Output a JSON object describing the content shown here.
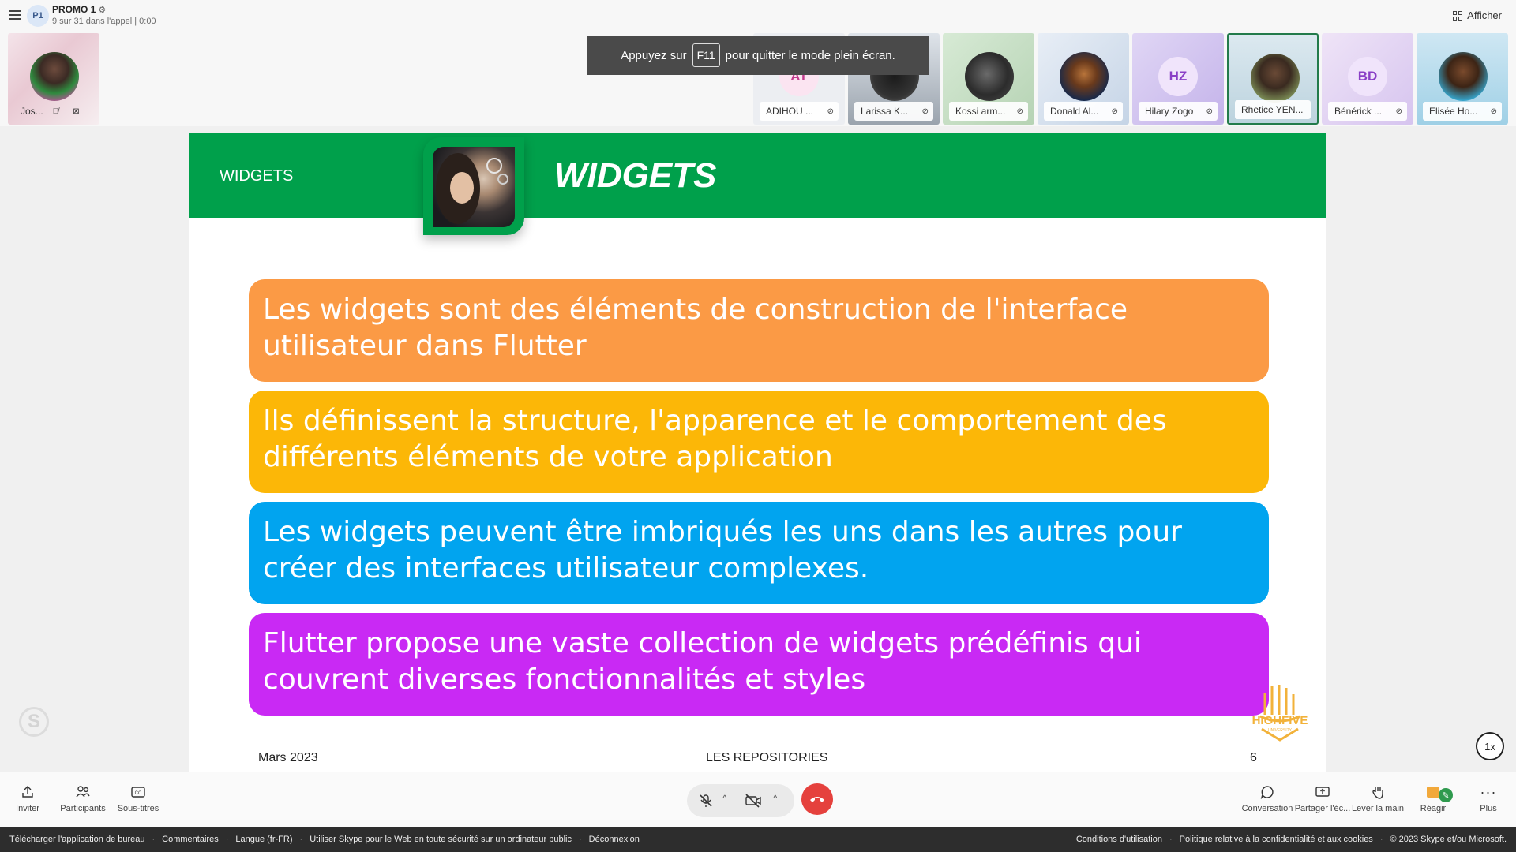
{
  "header": {
    "group_initials": "P1",
    "title": "PROMO 1",
    "subtitle": "9 sur 31 dans l'appel | 0:00",
    "view_label": "Afficher"
  },
  "self_tile": {
    "name": "Jos..."
  },
  "fullscreen_toast": {
    "before": "Appuyez sur",
    "key": "F11",
    "after": "pour quitter le mode plein écran."
  },
  "participants": [
    {
      "name": "ADIHOU ...",
      "initials": "AT"
    },
    {
      "name": "Larissa K...",
      "initials": ""
    },
    {
      "name": "Kossi arm...",
      "initials": ""
    },
    {
      "name": "Donald Al...",
      "initials": ""
    },
    {
      "name": "Hilary Zogo",
      "initials": "HZ"
    },
    {
      "name": "Rhetice YEN...",
      "initials": ""
    },
    {
      "name": "Bénérick ...",
      "initials": "BD"
    },
    {
      "name": "Elisée Ho...",
      "initials": ""
    }
  ],
  "slide": {
    "band_label": "WIDGETS",
    "title": "WIDGETS",
    "points": [
      "Les widgets sont des éléments de construction de l'interface utilisateur dans Flutter",
      "Ils définissent la structure, l'apparence et le comportement des différents éléments de votre application",
      "Les widgets peuvent être imbriqués les uns dans les autres pour créer des interfaces utilisateur complexes.",
      "Flutter propose une vaste collection de widgets prédéfinis qui couvrent diverses fonctionnalités et styles"
    ],
    "logo_text": "HIGHFIVE",
    "logo_subtext": "UNIVERSITY",
    "footer_date": "Mars 2023",
    "footer_center": "LES REPOSITORIES",
    "footer_page": "6"
  },
  "speed": "1x",
  "toolbar": {
    "invite": "Inviter",
    "participants": "Participants",
    "captions": "Sous-titres",
    "conversation": "Conversation",
    "share": "Partager l'éc...",
    "raise_hand": "Lever la main",
    "react": "Réagir",
    "more": "Plus"
  },
  "statusbar": {
    "left": [
      "Télécharger l'application de bureau",
      "Commentaires",
      "Langue (fr-FR)",
      "Utiliser Skype pour le Web en toute sécurité sur un ordinateur public",
      "Déconnexion"
    ],
    "right": [
      "Conditions d'utilisation",
      "Politique relative à la confidentialité et aux cookies",
      "© 2023 Skype et/ou Microsoft."
    ]
  },
  "colors": {
    "slide_green": "#00a04b",
    "box_orange": "#fb9a45",
    "box_yellow": "#fcb707",
    "box_blue": "#01a4ef",
    "box_purple": "#c929f4",
    "hangup_red": "#e5413d",
    "logo_gold": "#f2b23a"
  }
}
